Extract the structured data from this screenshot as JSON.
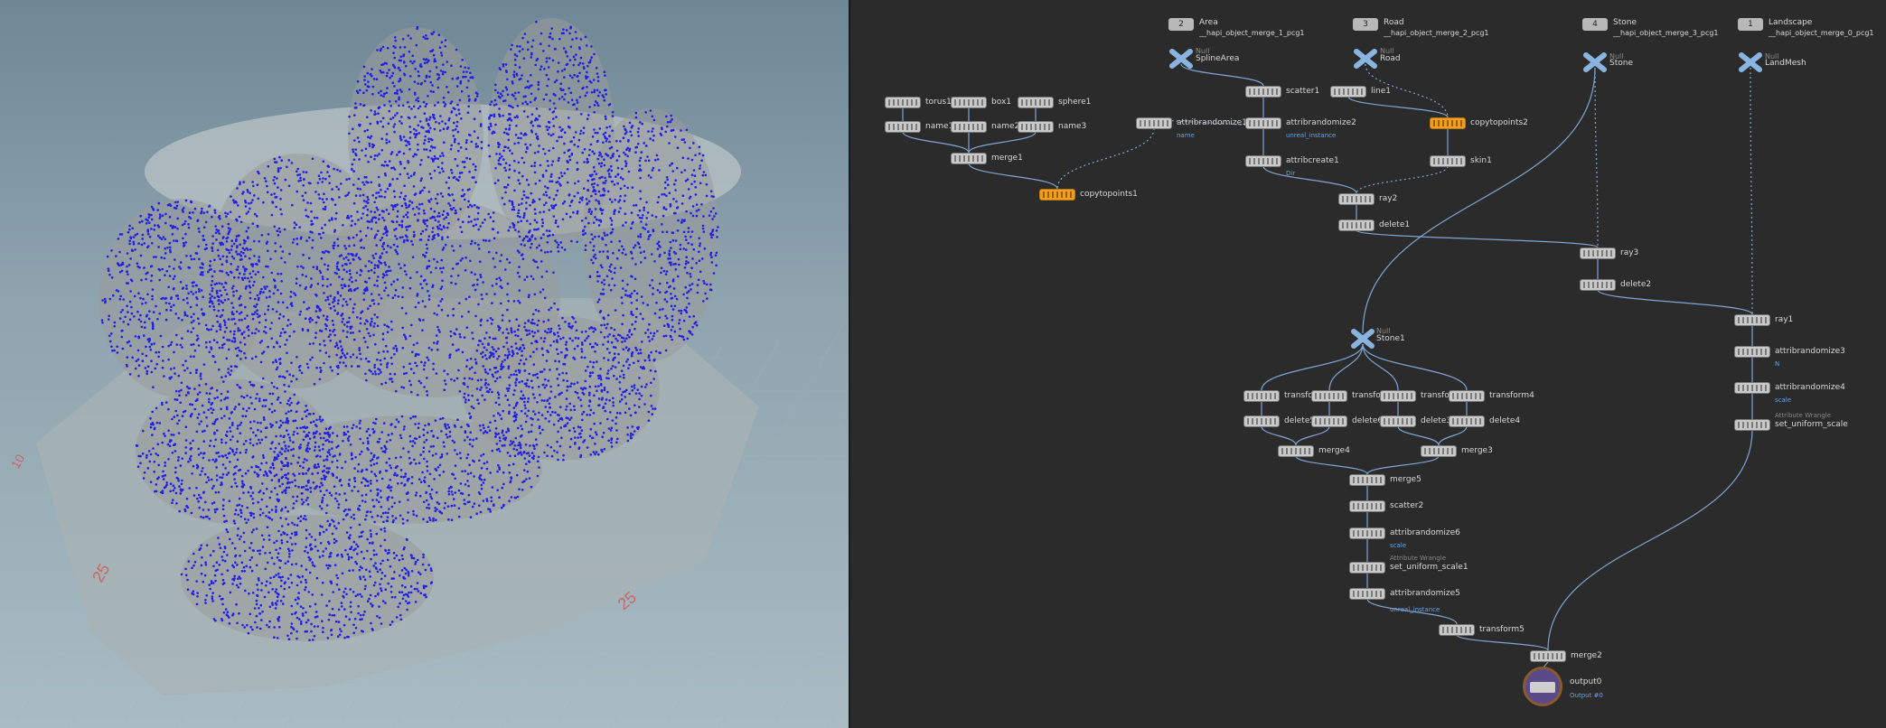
{
  "viewport": {
    "grid_labels": [
      "25",
      "25",
      "10"
    ],
    "colors": {
      "sky_top": "#6f8796",
      "sky_bottom": "#a9bcc4",
      "points": "#1f1fe6",
      "mesh": "#8d8d8d"
    }
  },
  "network": {
    "object_merges": [
      {
        "num": "2",
        "name": "Area",
        "path": "__hapi_object_merge_1_pcg1",
        "sop": "SplineArea"
      },
      {
        "num": "3",
        "name": "Road",
        "path": "__hapi_object_merge_2_pcg1",
        "sop": "Road"
      },
      {
        "num": "4",
        "name": "Stone",
        "path": "__hapi_object_merge_3_pcg1",
        "sop": "Stone"
      },
      {
        "num": "1",
        "name": "Landscape",
        "path": "__hapi_object_merge_0_pcg1",
        "sop": "LandMesh"
      }
    ],
    "nodes": {
      "torus1": "torus1",
      "box1": "box1",
      "sphere1": "sphere1",
      "name1": "name1",
      "name2": "name2",
      "name3": "name3",
      "merge1": "merge1",
      "copytopoints1": "copytopoints1",
      "attribrandomize1": "attribrandomize1",
      "attribrandomize1_sub": "name",
      "scatter1": "scatter1",
      "line1": "line1",
      "attribrandomize2": "attribrandomize2",
      "attribrandomize2_sub": "unreal_instance",
      "copytopoints2": "copytopoints2",
      "attribcreate1": "attribcreate1",
      "attribcreate1_sub": "Dir",
      "skin1": "skin1",
      "ray2": "ray2",
      "delete1": "delete1",
      "ray3": "ray3",
      "delete2": "delete2",
      "ray1": "ray1",
      "attribrandomize3": "attribrandomize3",
      "attribrandomize3_sub": "N",
      "attribrandomize4": "attribrandomize4",
      "attribrandomize4_sub": "scale",
      "set_uniform_scale": "set_uniform_scale",
      "set_uniform_scale_top": "Attribute Wrangle",
      "stone1": "Stone1",
      "transform1": "transform1",
      "transform2": "transform2",
      "transform3": "transform3",
      "transform4": "transform4",
      "delete5": "delete5",
      "delete6": "delete6",
      "delete3": "delete3",
      "delete4": "delete4",
      "merge4": "merge4",
      "merge3": "merge3",
      "merge5": "merge5",
      "scatter2": "scatter2",
      "attribrandomize6": "attribrandomize6",
      "attribrandomize6_sub": "scale",
      "set_uniform_scale1": "set_uniform_scale1",
      "set_uniform_scale1_top": "Attribute Wrangle",
      "attribrandomize5": "attribrandomize5",
      "attribrandomize5_sub": "unreal_instance",
      "transform5": "transform5",
      "merge2": "merge2",
      "output0": "output0",
      "output0_sub": "Output #0"
    },
    "xnode_tag": "Null"
  }
}
